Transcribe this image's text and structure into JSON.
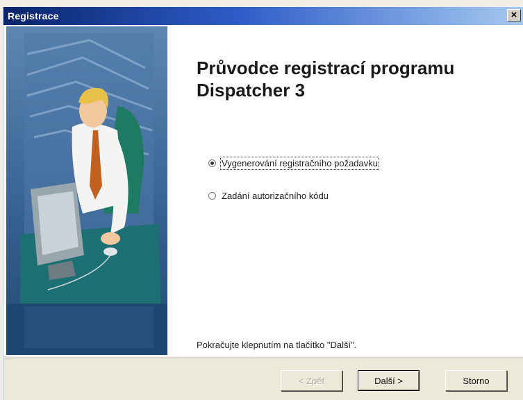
{
  "window": {
    "title": "Registrace",
    "close_glyph": "×"
  },
  "wizard": {
    "title": "Průvodce registrací programu Dispatcher 3",
    "options": [
      {
        "label": "Vygenerování registračního požadavku",
        "selected": true
      },
      {
        "label": "Zadání autorizačního kódu",
        "selected": false
      }
    ],
    "hint": "Pokračujte klepnutím na tlačítko \"Další\"."
  },
  "buttons": {
    "back": "< Zpět",
    "next": "Další >",
    "cancel": "Storno"
  },
  "icons": [
    "close-icon",
    "wizard-illustration"
  ],
  "colors": {
    "titlebar_start": "#0a246a",
    "titlebar_end": "#a6caf0",
    "side_panel": "#2b5a87",
    "dialog_bg": "#ece9d8"
  }
}
